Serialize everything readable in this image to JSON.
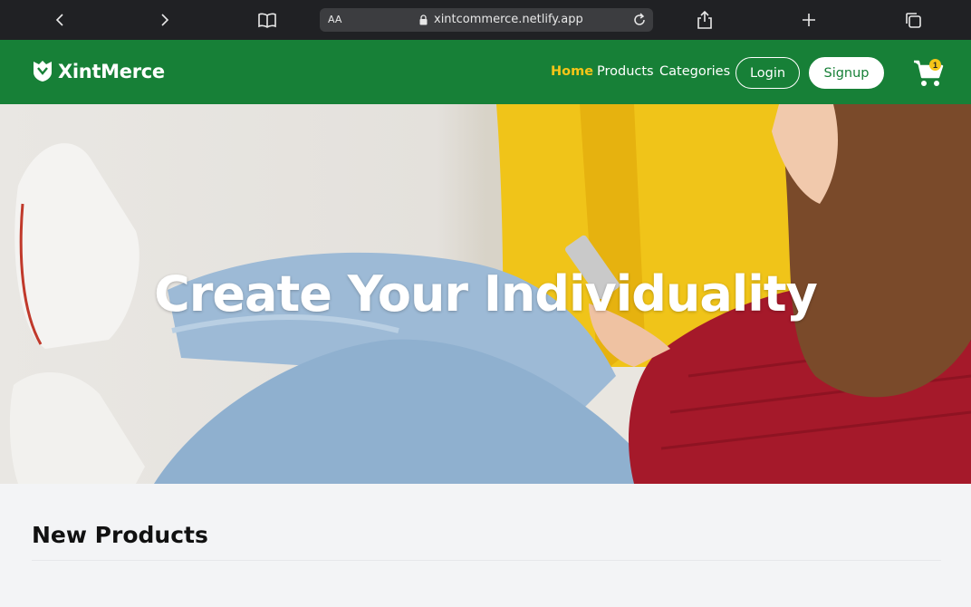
{
  "browser": {
    "text_size_label": "AA",
    "url": "xintcommerce.netlify.app"
  },
  "nav": {
    "brand": "XintMerce",
    "links": [
      {
        "label": "Home",
        "active": true
      },
      {
        "label": "Products",
        "active": false
      },
      {
        "label": "Categories",
        "active": false
      }
    ],
    "login_label": "Login",
    "signup_label": "Signup",
    "cart_count": "1",
    "colors": {
      "primary": "#178037",
      "accent": "#f6c518"
    }
  },
  "hero": {
    "title": "Create Your Individuality"
  },
  "sections": {
    "new_products_title": "New Products"
  }
}
